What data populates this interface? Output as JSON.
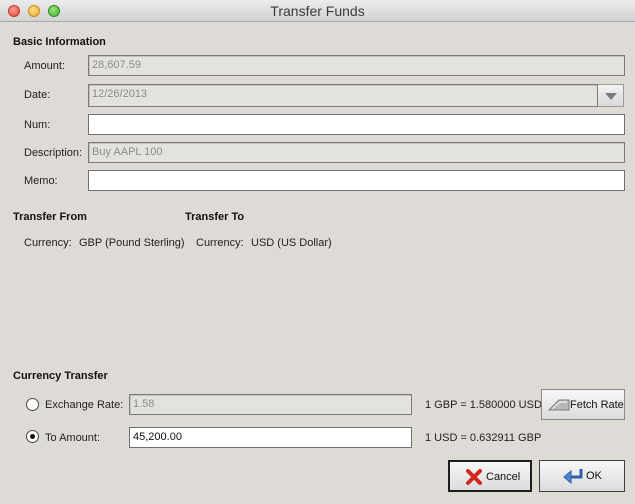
{
  "window": {
    "title": "Transfer Funds"
  },
  "basic": {
    "title": "Basic Information",
    "amount": {
      "label": "Amount:",
      "value": "28,607.59"
    },
    "date": {
      "label": "Date:",
      "value": "12/26/2013"
    },
    "num": {
      "label": "Num:",
      "value": ""
    },
    "description": {
      "label": "Description:",
      "value": "Buy AAPL 100"
    },
    "memo": {
      "label": "Memo:",
      "value": ""
    }
  },
  "transfer_from": {
    "title": "Transfer From",
    "currency_label": "Currency:",
    "currency_value": "GBP (Pound Sterling)"
  },
  "transfer_to": {
    "title": "Transfer To",
    "currency_label": "Currency:",
    "currency_value": "USD (US Dollar)"
  },
  "currency_transfer": {
    "title": "Currency Transfer",
    "exchange_rate": {
      "label": "Exchange Rate:",
      "value": "1.58",
      "selected": false,
      "conversion": "1 GBP = 1.580000 USD"
    },
    "to_amount": {
      "label": "To Amount:",
      "value": "45,200.00",
      "selected": true,
      "conversion": "1 USD = 0.632911 GBP"
    },
    "fetch_rate_label": "Fetch Rate"
  },
  "buttons": {
    "cancel": "Cancel",
    "ok": "OK"
  },
  "icons": {
    "fetch": "fetch-rate-icon",
    "cancel": "red-x-icon",
    "ok": "return-arrow-icon",
    "dropdown": "chevron-down-icon"
  }
}
